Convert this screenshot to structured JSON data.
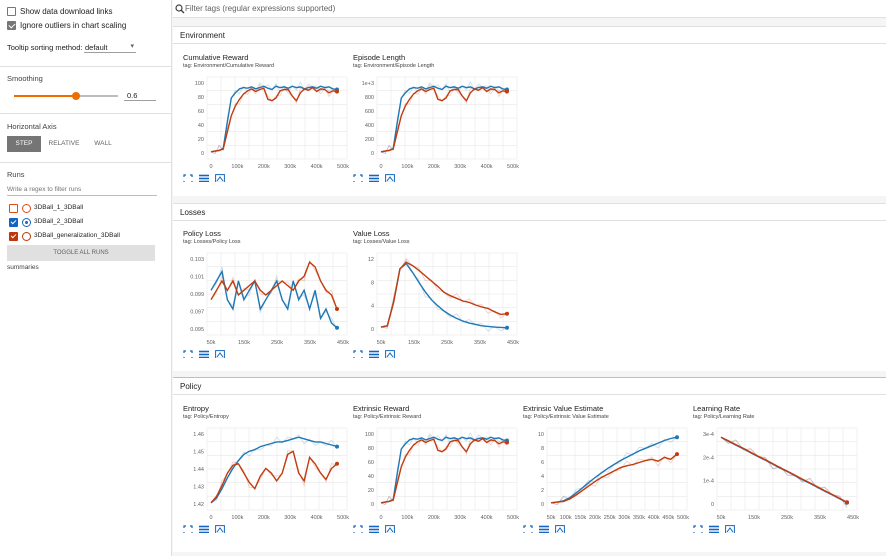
{
  "sidebar": {
    "show_download_links": "Show data download links",
    "ignore_outliers": "Ignore outliers in chart scaling",
    "tooltip_label": "Tooltip sorting method:",
    "tooltip_value": "default",
    "smoothing_label": "Smoothing",
    "smoothing_value": "0.6",
    "smoothing_fraction": 0.6,
    "horizontal_axis_label": "Horizontal Axis",
    "axis_step": "STEP",
    "axis_relative": "RELATIVE",
    "axis_wall": "WALL",
    "runs_label": "Runs",
    "runs_filter_placeholder": "Write a regex to filter runs",
    "runs": [
      {
        "name": "3DBall_1_3DBall",
        "color": "#e64a19",
        "checked": false
      },
      {
        "name": "3DBall_2_3DBall",
        "color": "#1565c0",
        "checked": true
      },
      {
        "name": "3DBall_generalization_3DBall",
        "color": "#bf360c",
        "checked": true
      }
    ],
    "toggle_all": "TOGGLE ALL RUNS",
    "summaries": "summaries"
  },
  "filter_placeholder": "Filter tags (regular expressions supported)",
  "sections": [
    {
      "title": "Environment"
    },
    {
      "title": "Losses"
    },
    {
      "title": "Policy"
    }
  ],
  "colors": {
    "blue": "#1f77b4",
    "orange": "#c23b0e",
    "accent": "#ef6c00"
  },
  "charts": [
    {
      "title": "Cumulative Reward",
      "tag": "tag: Environment/Cumulative Reward",
      "yticks": [
        "100",
        "80",
        "60",
        "40",
        "20",
        "0"
      ],
      "xticks": [
        "0",
        "100k",
        "200k",
        "300k",
        "400k",
        "500k"
      ],
      "series": [
        {
          "name": "3DBall_2_3DBall",
          "values": [
            0,
            1,
            2,
            5,
            45,
            82,
            90,
            96,
            98,
            97,
            99,
            96,
            98,
            100,
            97,
            95,
            100,
            98,
            99,
            97,
            100,
            98,
            99,
            96,
            98,
            99,
            97,
            100,
            98,
            99,
            96,
            95
          ]
        },
        {
          "name": "3DBall_generalization_3DBall",
          "values": [
            0,
            1,
            2,
            4,
            30,
            55,
            70,
            80,
            88,
            93,
            96,
            92,
            95,
            97,
            80,
            78,
            82,
            93,
            95,
            95,
            85,
            78,
            90,
            96,
            94,
            98,
            92,
            96,
            95,
            90,
            93,
            92
          ]
        }
      ]
    },
    {
      "title": "Episode Length",
      "tag": "tag: Environment/Episode Length",
      "yticks": [
        "1e+3",
        "800",
        "600",
        "400",
        "200",
        "0"
      ],
      "xticks": [
        "0",
        "100k",
        "200k",
        "300k",
        "400k",
        "500k"
      ],
      "series": [
        {
          "name": "3DBall_2_3DBall",
          "values": [
            0,
            1,
            2,
            5,
            45,
            82,
            90,
            96,
            98,
            97,
            99,
            96,
            98,
            100,
            97,
            95,
            100,
            98,
            99,
            97,
            100,
            98,
            99,
            96,
            98,
            99,
            97,
            100,
            98,
            99,
            96,
            95
          ]
        },
        {
          "name": "3DBall_generalization_3DBall",
          "values": [
            0,
            1,
            2,
            4,
            30,
            55,
            70,
            80,
            88,
            93,
            96,
            92,
            95,
            97,
            80,
            78,
            82,
            93,
            95,
            95,
            85,
            78,
            90,
            96,
            94,
            98,
            92,
            96,
            95,
            90,
            93,
            92
          ]
        }
      ]
    },
    {
      "title": "Policy Loss",
      "tag": "tag: Losses/Policy Loss",
      "yticks": [
        "0.103",
        "0.101",
        "0.099",
        "0.097",
        "0.095"
      ],
      "xticks": [
        "50k",
        "150k",
        "250k",
        "350k",
        "450k"
      ],
      "series": [
        {
          "name": "3DBall_2_3DBall",
          "values": [
            0.099,
            0.1,
            0.101,
            0.098,
            0.097,
            0.1,
            0.098,
            0.099,
            0.1,
            0.097,
            0.098,
            0.099,
            0.1,
            0.098,
            0.097,
            0.1,
            0.098,
            0.099,
            0.097,
            0.099,
            0.096,
            0.097,
            0.0955,
            0.095
          ]
        },
        {
          "name": "3DBall_generalization_3DBall",
          "values": [
            0.098,
            0.099,
            0.1,
            0.099,
            0.1,
            0.0985,
            0.099,
            0.0995,
            0.1,
            0.099,
            0.0985,
            0.099,
            0.0995,
            0.1,
            0.0995,
            0.099,
            0.1,
            0.1005,
            0.102,
            0.1015,
            0.1,
            0.099,
            0.0985,
            0.097
          ]
        }
      ]
    },
    {
      "title": "Value Loss",
      "tag": "tag: Losses/Value Loss",
      "yticks": [
        "12",
        "8",
        "4",
        "0"
      ],
      "xticks": [
        "50k",
        "150k",
        "250k",
        "350k",
        "450k"
      ],
      "series": [
        {
          "name": "3DBall_2_3DBall",
          "values": [
            0.3,
            0.5,
            4,
            9,
            9.8,
            8.5,
            7,
            5.6,
            4.4,
            3.5,
            2.7,
            2.1,
            1.6,
            1.2,
            0.9,
            0.7,
            0.5,
            0.4,
            0.3,
            0.25,
            0.2
          ]
        },
        {
          "name": "3DBall_generalization_3DBall",
          "values": [
            0.3,
            0.5,
            4,
            9,
            10,
            9.5,
            8.8,
            8,
            7.2,
            6.4,
            5.5,
            5,
            4.6,
            4.2,
            4,
            3.6,
            3.3,
            3.1,
            2.6,
            2.2,
            2.3
          ]
        }
      ]
    },
    {
      "title": "Entropy",
      "tag": "tag: Policy/Entropy",
      "yticks": [
        "1.46",
        "1.45",
        "1.44",
        "1.43",
        "1.42"
      ],
      "xticks": [
        "0",
        "100k",
        "200k",
        "300k",
        "400k",
        "500k"
      ],
      "series": [
        {
          "name": "3DBall_2_3DBall",
          "values": [
            1.421,
            1.424,
            1.43,
            1.437,
            1.443,
            1.448,
            1.452,
            1.454,
            1.455,
            1.457,
            1.458,
            1.459,
            1.46,
            1.46,
            1.461,
            1.462,
            1.463,
            1.462,
            1.461,
            1.46,
            1.46,
            1.459,
            1.458,
            1.457
          ]
        },
        {
          "name": "3DBall_generalization_3DBall",
          "values": [
            1.421,
            1.425,
            1.432,
            1.44,
            1.445,
            1.446,
            1.44,
            1.434,
            1.43,
            1.438,
            1.443,
            1.44,
            1.435,
            1.44,
            1.452,
            1.454,
            1.44,
            1.435,
            1.45,
            1.446,
            1.44,
            1.436,
            1.443,
            1.446
          ]
        }
      ]
    },
    {
      "title": "Extrinsic Reward",
      "tag": "tag: Policy/Extrinsic Reward",
      "yticks": [
        "100",
        "80",
        "60",
        "40",
        "20",
        "0"
      ],
      "xticks": [
        "0",
        "100k",
        "200k",
        "300k",
        "400k",
        "500k"
      ],
      "series": [
        {
          "name": "3DBall_2_3DBall",
          "values": [
            0,
            1,
            2,
            5,
            45,
            82,
            90,
            96,
            98,
            97,
            99,
            96,
            98,
            100,
            97,
            95,
            100,
            98,
            99,
            97,
            100,
            98,
            99,
            96,
            98,
            99,
            97,
            100,
            98,
            99,
            96,
            95
          ]
        },
        {
          "name": "3DBall_generalization_3DBall",
          "values": [
            0,
            1,
            2,
            4,
            30,
            55,
            70,
            80,
            88,
            93,
            96,
            92,
            95,
            97,
            80,
            78,
            82,
            93,
            95,
            95,
            85,
            78,
            90,
            96,
            94,
            98,
            92,
            96,
            95,
            90,
            93,
            92
          ]
        }
      ]
    },
    {
      "title": "Extrinsic Value Estimate",
      "tag": "tag: Policy/Extrinsic Value Estimate",
      "yticks": [
        "10",
        "8",
        "6",
        "4",
        "2",
        "0"
      ],
      "xticks": [
        "50k",
        "100k",
        "150k",
        "200k",
        "250k",
        "300k",
        "350k",
        "400k",
        "450k",
        "500k"
      ],
      "series": [
        {
          "name": "3DBall_2_3DBall",
          "values": [
            0,
            0.1,
            0.3,
            0.8,
            1.5,
            2.3,
            3.1,
            3.9,
            4.6,
            5.3,
            5.9,
            6.5,
            7,
            7.5,
            8,
            8.4,
            8.8,
            9.2,
            9.6,
            9.9,
            10.1
          ]
        },
        {
          "name": "3DBall_generalization_3DBall",
          "values": [
            0,
            0.1,
            0.2,
            0.6,
            1.2,
            1.9,
            2.6,
            3.3,
            3.9,
            4.4,
            4.9,
            5.4,
            5.7,
            5.9,
            6.2,
            6.5,
            6.7,
            6.4,
            7,
            6.7,
            7.5
          ]
        }
      ]
    },
    {
      "title": "Learning Rate",
      "tag": "tag: Policy/Learning Rate",
      "yticks": [
        "3e-4",
        "2e-4",
        "1e-4",
        "0"
      ],
      "xticks": [
        "50k",
        "150k",
        "250k",
        "350k",
        "450k"
      ],
      "series": [
        {
          "name": "3DBall_2_3DBall",
          "values": [
            3.0,
            2.83,
            2.66,
            2.5,
            2.33,
            2.16,
            2.0,
            1.83,
            1.66,
            1.5,
            1.33,
            1.16,
            1.0,
            0.83,
            0.66,
            0.5,
            0.33,
            0.16
          ]
        },
        {
          "name": "3DBall_generalization_3DBall",
          "values": [
            3.0,
            2.85,
            2.68,
            2.52,
            2.35,
            2.18,
            2.02,
            1.85,
            1.68,
            1.52,
            1.35,
            1.18,
            1.02,
            0.85,
            0.68,
            0.52,
            0.35,
            0.18
          ]
        }
      ]
    }
  ]
}
